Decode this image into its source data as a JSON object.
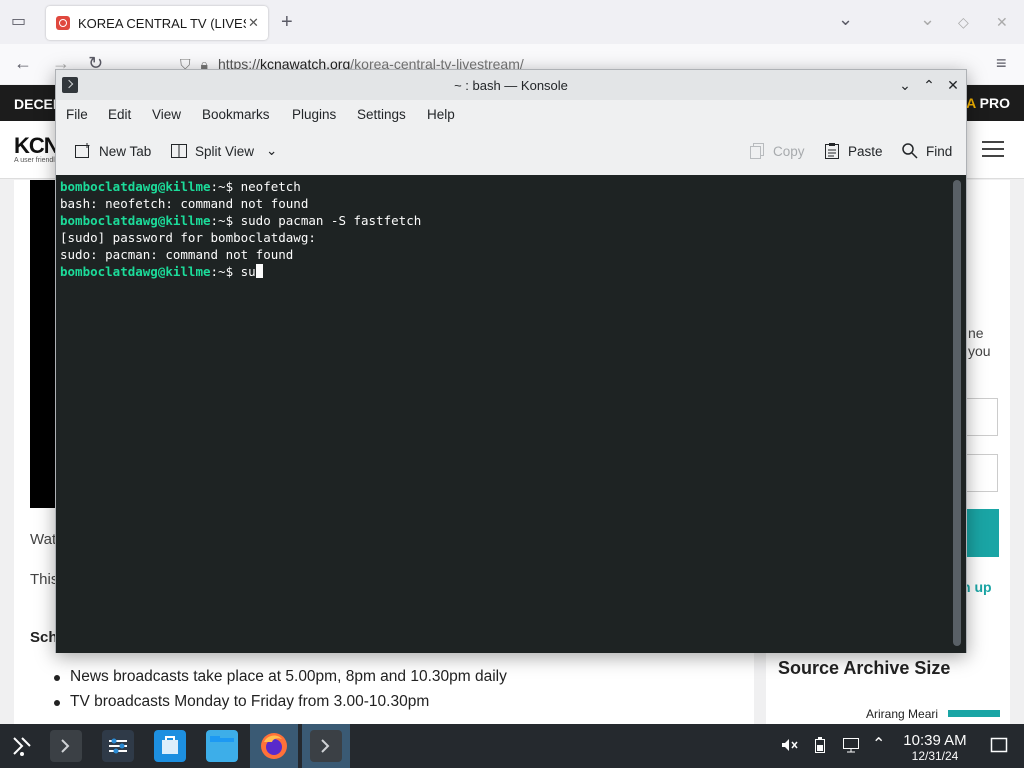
{
  "browser": {
    "tab_title": "KOREA CENTRAL TV (LIVES",
    "tab_close": "✕",
    "new_tab": "+",
    "url_scheme": "https://",
    "url_host": "kcnawatch.org",
    "url_path": "/korea-central-tv-livestream/",
    "back": "←",
    "forward": "→",
    "reload": "↻",
    "tab_list": "⌄",
    "minimize": "⌄",
    "maximize": "◇",
    "close": "✕",
    "menu": "≡",
    "bookmark_star": "☆"
  },
  "site": {
    "topbar_left": "DECEN",
    "topbar_right_accent": "A",
    "topbar_right": " PRO",
    "logo": "KCN",
    "logo_sub": "A user friendl",
    "frag_wat": "Wat",
    "frag_this": "This",
    "frag_sch": "Sch",
    "side_ne": "ne",
    "side_you": "you",
    "side_up": "n up",
    "schedule": [
      "News broadcasts take place at 5.00pm, 8pm and 10.30pm daily",
      "TV broadcasts Monday to Friday from 3.00-10.30pm"
    ],
    "archive_title": "Source Archive Size",
    "archive_label": "Arirang Meari"
  },
  "konsole": {
    "title": "~ : bash — Konsole",
    "wbtn_min": "⌄",
    "wbtn_max": "⌃",
    "wbtn_close": "✕",
    "menu": [
      "File",
      "Edit",
      "View",
      "Bookmarks",
      "Plugins",
      "Settings",
      "Help"
    ],
    "toolbar": {
      "new_tab": "New Tab",
      "split_view": "Split View",
      "split_arrow": "⌄",
      "copy": "Copy",
      "paste": "Paste",
      "find": "Find"
    },
    "terminal": {
      "prompt": "bomboclatdawg@killme",
      "prompt_suffix": ":~$ ",
      "cmd1": "neofetch",
      "out1": "bash: neofetch: command not found",
      "cmd2": "sudo pacman -S fastfetch",
      "out2a": "[sudo] password for bomboclatdawg:",
      "out2b": "sudo: pacman: command not found",
      "cmd3": "su"
    }
  },
  "taskbar": {
    "time": "10:39 AM",
    "date": "12/31/24",
    "tray_arrow": "⌃"
  }
}
